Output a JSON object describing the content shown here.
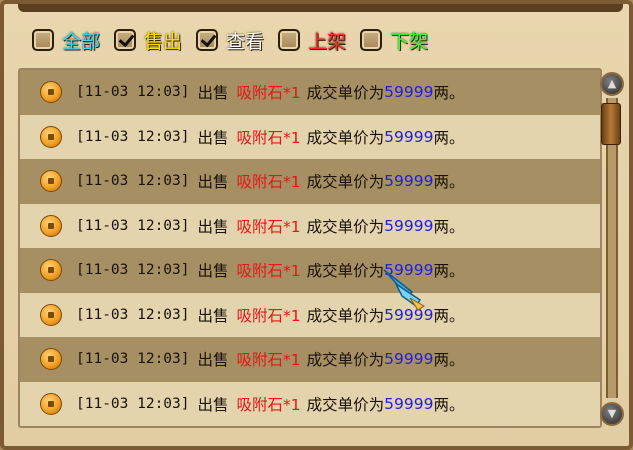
{
  "filters": [
    {
      "label": "全部",
      "checked": false,
      "color": "#38d8ff"
    },
    {
      "label": "售出",
      "checked": true,
      "color": "#ffe100"
    },
    {
      "label": "查看",
      "checked": true,
      "color": "#ffffff"
    },
    {
      "label": "上架",
      "checked": false,
      "color": "#ff2a2a"
    },
    {
      "label": "下架",
      "checked": false,
      "color": "#34ff34"
    }
  ],
  "rows": [
    {
      "time": "[11-03 12:03]",
      "action": "出售",
      "item": "吸附石*1",
      "text": "成交单价为",
      "price": "59999",
      "unit": "两。"
    },
    {
      "time": "[11-03 12:03]",
      "action": "出售",
      "item": "吸附石*1",
      "text": "成交单价为",
      "price": "59999",
      "unit": "两。"
    },
    {
      "time": "[11-03 12:03]",
      "action": "出售",
      "item": "吸附石*1",
      "text": "成交单价为",
      "price": "59999",
      "unit": "两。"
    },
    {
      "time": "[11-03 12:03]",
      "action": "出售",
      "item": "吸附石*1",
      "text": "成交单价为",
      "price": "59999",
      "unit": "两。"
    },
    {
      "time": "[11-03 12:03]",
      "action": "出售",
      "item": "吸附石*1",
      "text": "成交单价为",
      "price": "59999",
      "unit": "两。"
    },
    {
      "time": "[11-03 12:03]",
      "action": "出售",
      "item": "吸附石*1",
      "text": "成交单价为",
      "price": "59999",
      "unit": "两。"
    },
    {
      "time": "[11-03 12:03]",
      "action": "出售",
      "item": "吸附石*1",
      "text": "成交单价为",
      "price": "59999",
      "unit": "两。"
    },
    {
      "time": "[11-03 12:03]",
      "action": "出售",
      "item": "吸附石*1",
      "text": "成交单价为",
      "price": "59999",
      "unit": "两。"
    }
  ],
  "icons": {
    "row": "gold-coin-icon",
    "scroll_up": "scroll-up-icon",
    "scroll_down": "scroll-down-icon",
    "cursor": "crystal-pointer-icon"
  }
}
